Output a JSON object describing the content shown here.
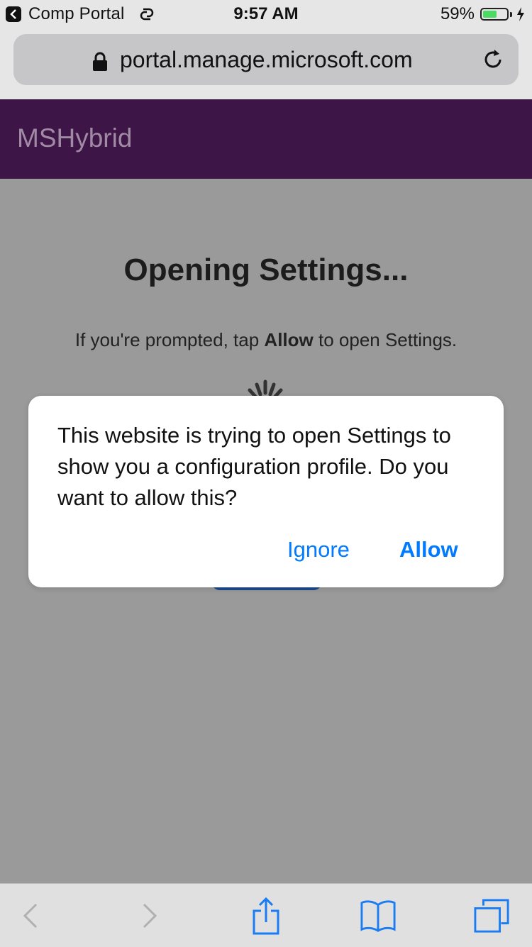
{
  "status_bar": {
    "back_app": "Comp Portal",
    "time": "9:57 AM",
    "battery_percent": "59%",
    "battery_level": 0.59
  },
  "url_bar": {
    "url": "portal.manage.microsoft.com"
  },
  "header": {
    "title": "MSHybrid"
  },
  "page": {
    "heading": "Opening Settings...",
    "prompt_prefix": "If you're prompted, tap ",
    "prompt_bold": "Allow",
    "prompt_suffix": " to open Settings."
  },
  "dialog": {
    "message": "This website is trying to open Settings to show you a configuration profile. Do you want to allow this?",
    "ignore_label": "Ignore",
    "allow_label": "Allow"
  },
  "toolbar": {
    "icons": [
      "back-icon",
      "forward-icon",
      "share-icon",
      "bookmarks-icon",
      "tabs-icon"
    ]
  },
  "colors": {
    "header_bg": "#3e1547",
    "header_text": "#a08aa4",
    "ios_blue": "#007aff",
    "dim_bg": "#9a9a9a",
    "battery_green": "#4cd964"
  }
}
